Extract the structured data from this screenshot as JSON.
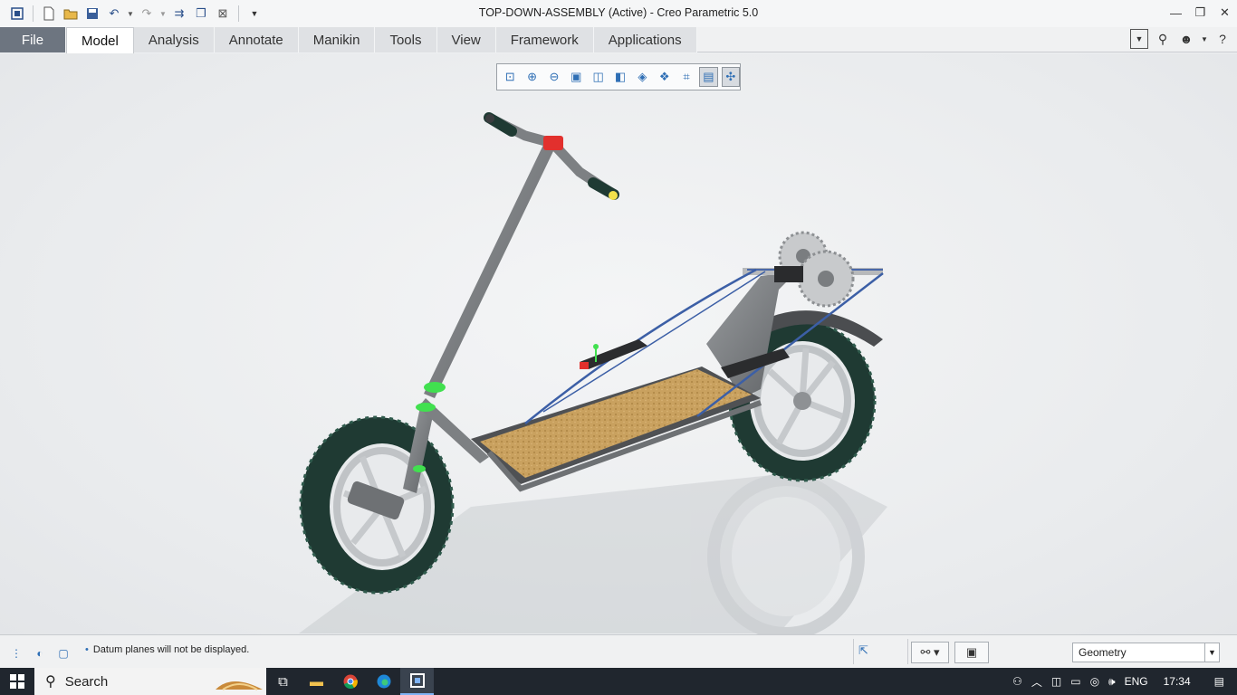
{
  "window": {
    "title": "TOP-DOWN-ASSEMBLY (Active) - Creo Parametric 5.0"
  },
  "quick_access": [
    "app-icon",
    "new-icon",
    "open-icon",
    "save-icon",
    "undo-icon",
    "redo-icon",
    "regenerate-icon",
    "windows-icon",
    "close-window-icon",
    "customize-icon"
  ],
  "ribbon": {
    "tabs": [
      {
        "label": "File"
      },
      {
        "label": "Model"
      },
      {
        "label": "Analysis"
      },
      {
        "label": "Annotate"
      },
      {
        "label": "Manikin"
      },
      {
        "label": "Tools"
      },
      {
        "label": "View"
      },
      {
        "label": "Framework"
      },
      {
        "label": "Applications"
      }
    ],
    "active_tab": "Model"
  },
  "view_toolbar": {
    "buttons": [
      "refit-icon",
      "zoom-in-icon",
      "zoom-out-icon",
      "repaint-icon",
      "perspective-icon",
      "saved-orientations-icon",
      "view-manager-icon",
      "display-style-icon",
      "datum-display-icon",
      "annotation-display-icon",
      "spin-center-icon"
    ]
  },
  "status": {
    "message": "Datum planes will not be displayed.",
    "selection_filter": "Geometry"
  },
  "taskbar": {
    "search_label": "Search",
    "language": "ENG",
    "time": "17:34"
  },
  "colors": {
    "tire": "#1f3a33",
    "deck": "#c9a15f",
    "frame": "#7d8083",
    "accent_green": "#41e04f",
    "accent_red": "#e2302d",
    "file_tab": "#6d7580"
  }
}
